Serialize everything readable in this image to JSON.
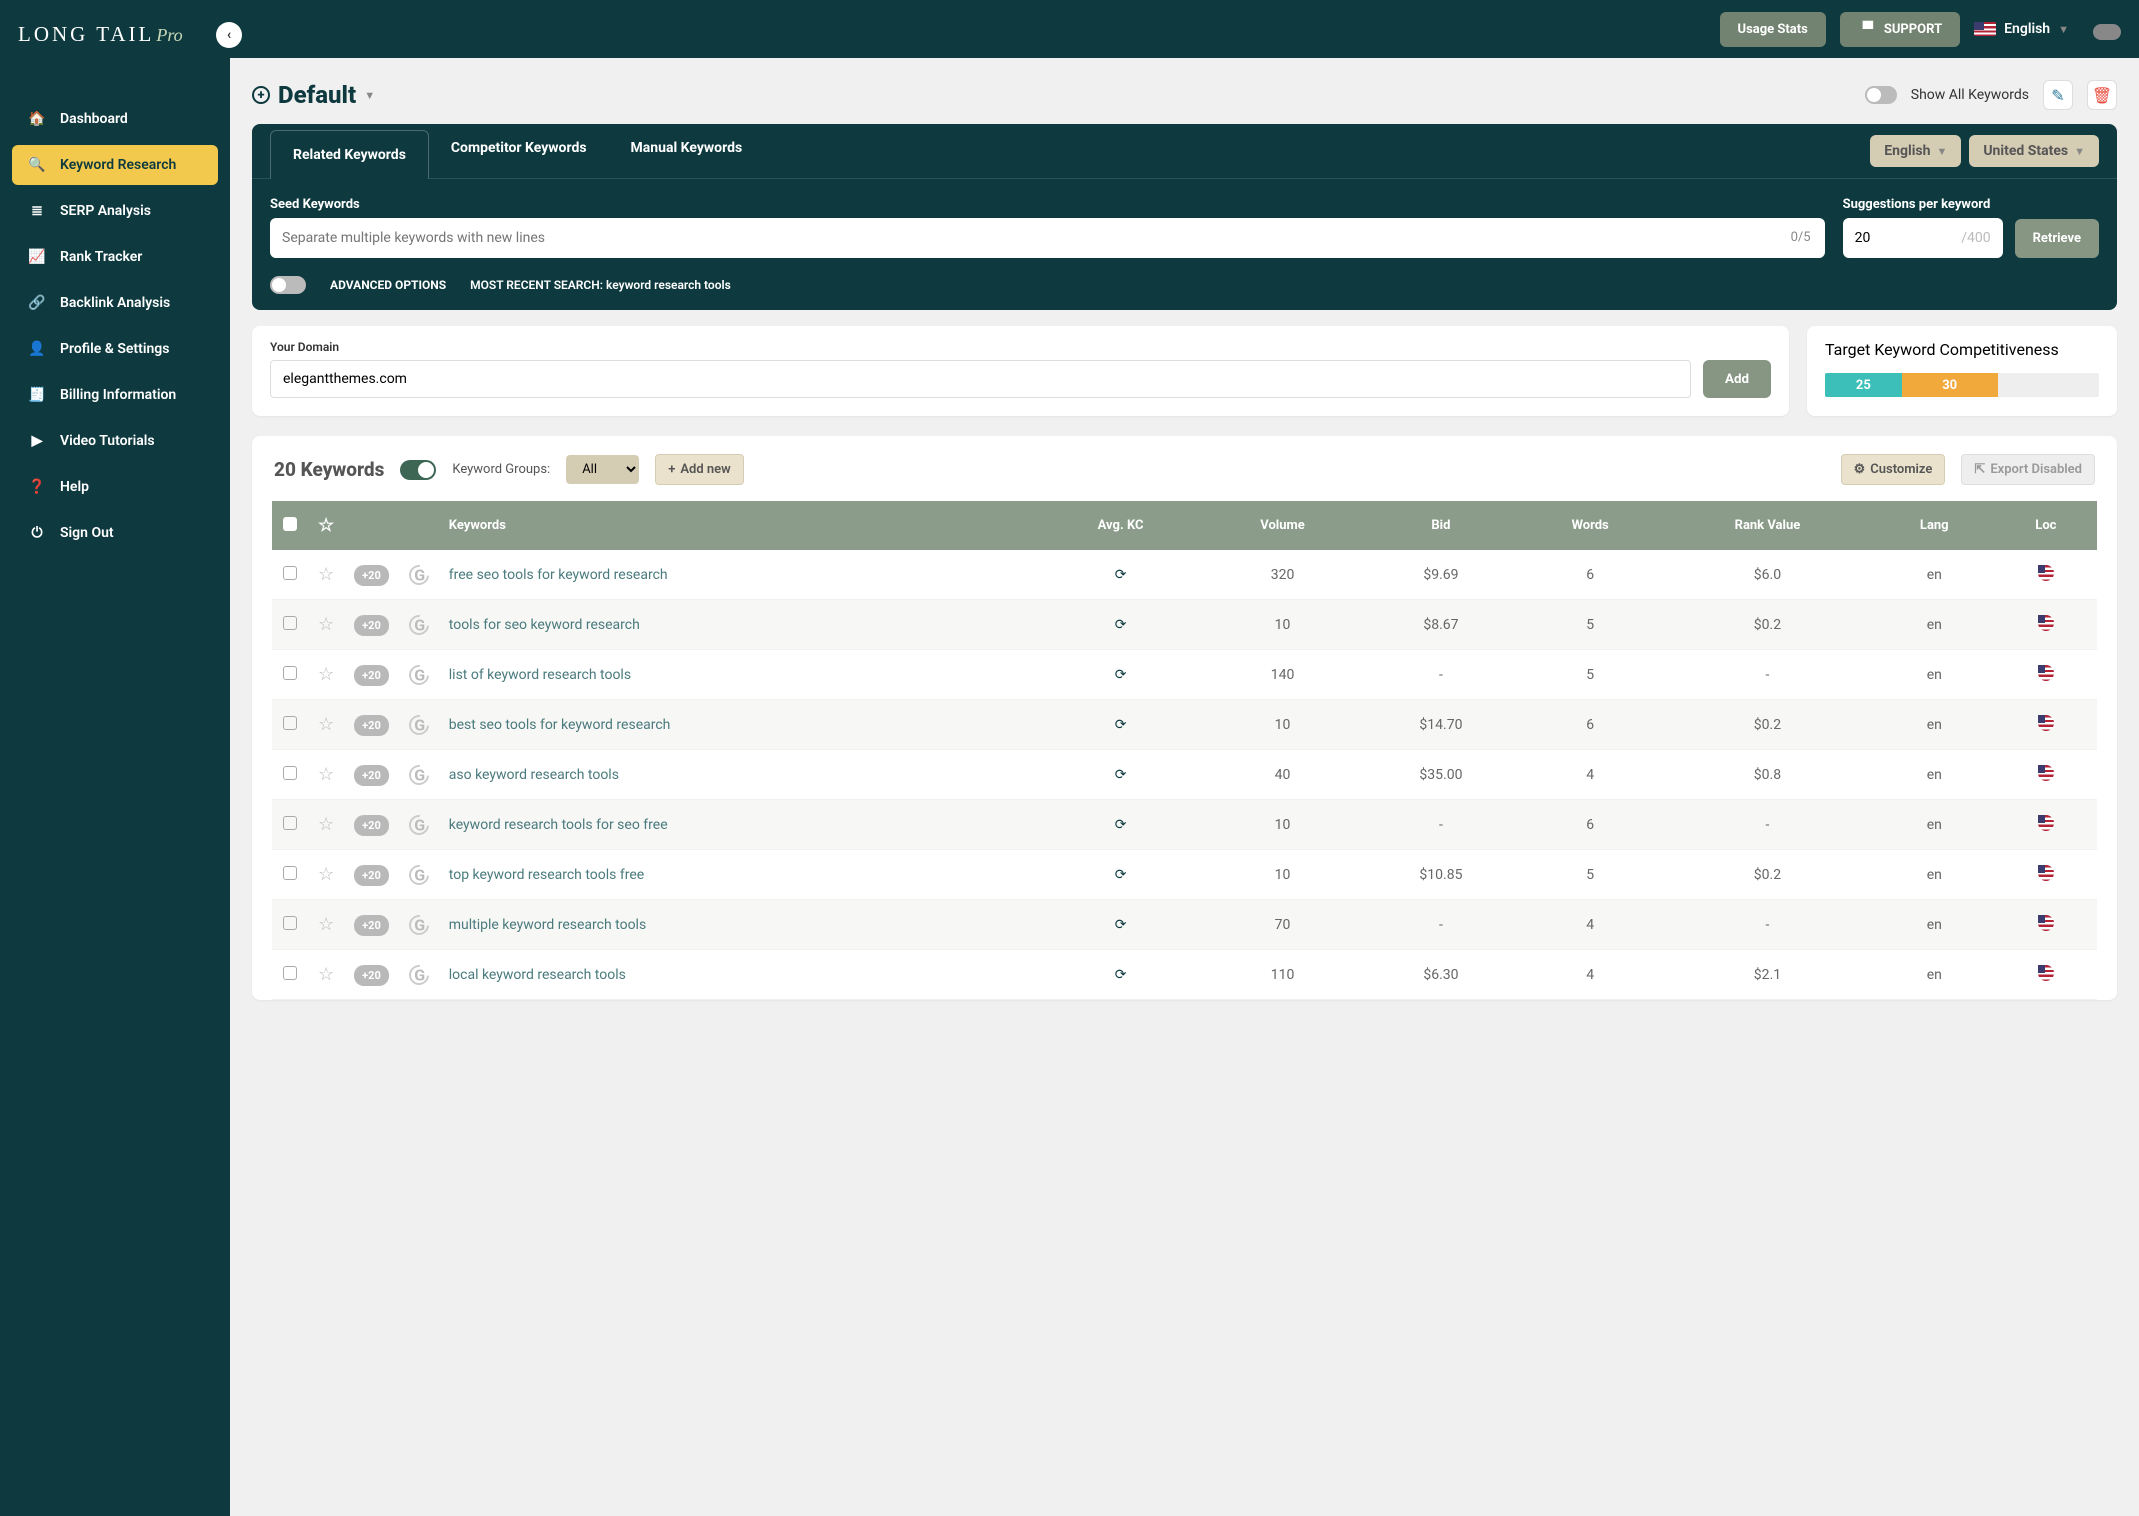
{
  "brand": {
    "name": "LONG TAIL",
    "suffix": "Pro"
  },
  "topbar": {
    "usage": "Usage Stats",
    "support": "SUPPORT",
    "language": "English"
  },
  "nav": [
    {
      "icon": "🏠",
      "label": "Dashboard",
      "active": false
    },
    {
      "icon": "🔍",
      "label": "Keyword Research",
      "active": true
    },
    {
      "icon": "≣",
      "label": "SERP Analysis",
      "active": false
    },
    {
      "icon": "📈",
      "label": "Rank Tracker",
      "active": false
    },
    {
      "icon": "🔗",
      "label": "Backlink Analysis",
      "active": false
    },
    {
      "icon": "👤",
      "label": "Profile & Settings",
      "active": false
    },
    {
      "icon": "🧾",
      "label": "Billing Information",
      "active": false
    },
    {
      "icon": "▶",
      "label": "Video Tutorials",
      "active": false
    },
    {
      "icon": "❓",
      "label": "Help",
      "active": false
    },
    {
      "icon": "⏻",
      "label": "Sign Out",
      "active": false
    }
  ],
  "project": {
    "name": "Default",
    "showAllLabel": "Show All Keywords"
  },
  "tabs": {
    "related": "Related Keywords",
    "competitor": "Competitor Keywords",
    "manual": "Manual Keywords"
  },
  "selectors": {
    "language": "English",
    "country": "United States"
  },
  "seed": {
    "label": "Seed Keywords",
    "placeholder": "Separate multiple keywords with new lines",
    "counter": "0/5"
  },
  "suggestions": {
    "label": "Suggestions per keyword",
    "value": "20",
    "max": "/400"
  },
  "retrieve": "Retrieve",
  "advanced": "ADVANCED OPTIONS",
  "recent": {
    "prefix": "MOST RECENT SEARCH: ",
    "value": "keyword research tools"
  },
  "domain": {
    "label": "Your Domain",
    "value": "elegantthemes.com",
    "add": "Add"
  },
  "kc": {
    "label": "Target Keyword Competitiveness",
    "low": "25",
    "mid": "30"
  },
  "results": {
    "count": "20 Keywords",
    "kgLabel": "Keyword Groups:",
    "kgValue": "All",
    "addNew": "Add new",
    "customize": "Customize",
    "export": "Export Disabled"
  },
  "columns": {
    "keywords": "Keywords",
    "kc": "Avg. KC",
    "volume": "Volume",
    "bid": "Bid",
    "words": "Words",
    "rank": "Rank Value",
    "lang": "Lang",
    "loc": "Loc"
  },
  "chip": "+20",
  "rows": [
    {
      "kw": "free seo tools for keyword research",
      "vol": "320",
      "bid": "$9.69",
      "words": "6",
      "rank": "$6.0",
      "lang": "en"
    },
    {
      "kw": "tools for seo keyword research",
      "vol": "10",
      "bid": "$8.67",
      "words": "5",
      "rank": "$0.2",
      "lang": "en"
    },
    {
      "kw": "list of keyword research tools",
      "vol": "140",
      "bid": "-",
      "words": "5",
      "rank": "-",
      "lang": "en"
    },
    {
      "kw": "best seo tools for keyword research",
      "vol": "10",
      "bid": "$14.70",
      "words": "6",
      "rank": "$0.2",
      "lang": "en"
    },
    {
      "kw": "aso keyword research tools",
      "vol": "40",
      "bid": "$35.00",
      "words": "4",
      "rank": "$0.8",
      "lang": "en"
    },
    {
      "kw": "keyword research tools for seo free",
      "vol": "10",
      "bid": "-",
      "words": "6",
      "rank": "-",
      "lang": "en"
    },
    {
      "kw": "top keyword research tools free",
      "vol": "10",
      "bid": "$10.85",
      "words": "5",
      "rank": "$0.2",
      "lang": "en"
    },
    {
      "kw": "multiple keyword research tools",
      "vol": "70",
      "bid": "-",
      "words": "4",
      "rank": "-",
      "lang": "en"
    },
    {
      "kw": "local keyword research tools",
      "vol": "110",
      "bid": "$6.30",
      "words": "4",
      "rank": "$2.1",
      "lang": "en"
    }
  ]
}
